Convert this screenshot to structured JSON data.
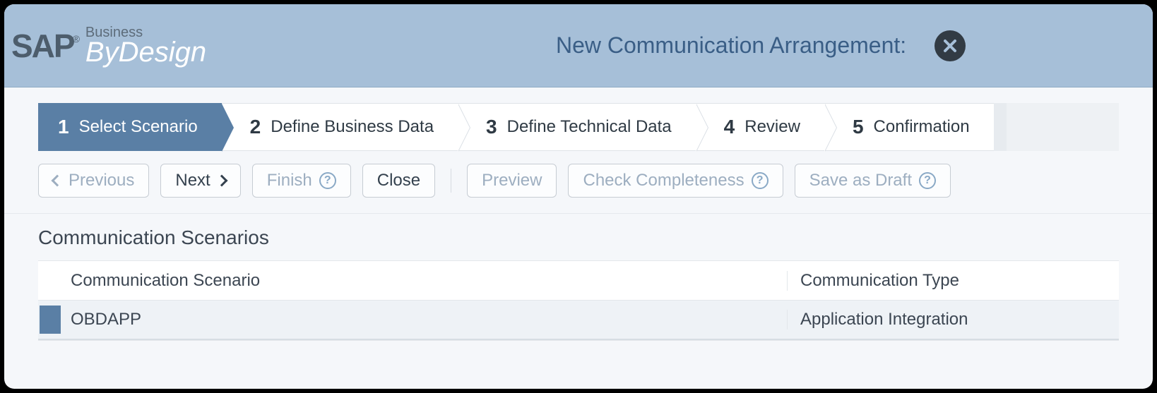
{
  "logo": {
    "brand": "SAP",
    "registered": "®",
    "line1": "Business",
    "line2": "ByDesign"
  },
  "header": {
    "title": "New Communication Arrangement:"
  },
  "wizard": {
    "steps": [
      {
        "num": "1",
        "label": "Select Scenario"
      },
      {
        "num": "2",
        "label": "Define Business Data"
      },
      {
        "num": "3",
        "label": "Define Technical Data"
      },
      {
        "num": "4",
        "label": "Review"
      },
      {
        "num": "5",
        "label": "Confirmation"
      }
    ],
    "active_index": 0
  },
  "toolbar": {
    "previous": "Previous",
    "next": "Next",
    "finish": "Finish",
    "close": "Close",
    "preview": "Preview",
    "check": "Check Completeness",
    "save_draft": "Save as Draft"
  },
  "section": {
    "title": "Communication Scenarios",
    "columns": {
      "scenario": "Communication Scenario",
      "type": "Communication Type"
    },
    "rows": [
      {
        "scenario": "OBDAPP",
        "type": "Application Integration",
        "selected": true
      }
    ]
  }
}
